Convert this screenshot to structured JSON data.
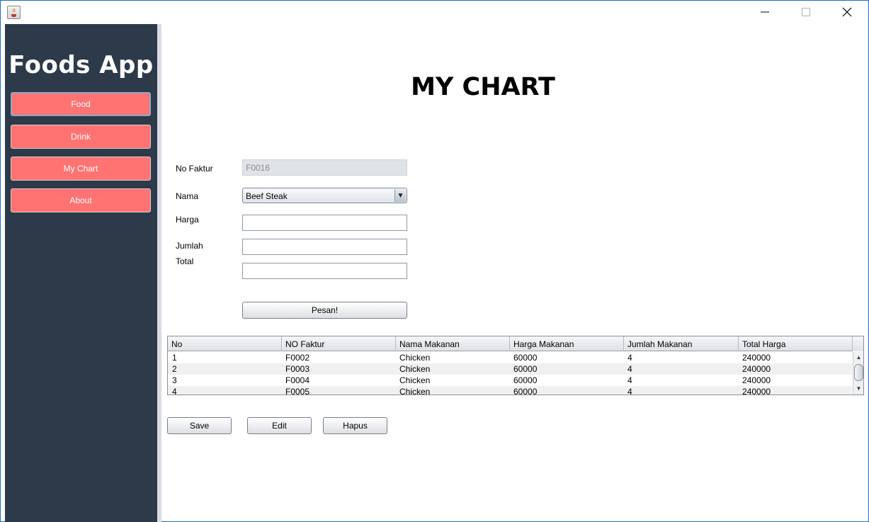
{
  "window": {
    "title": "",
    "colors": {
      "sidebar": "#2c3a4a",
      "nav_button": "#ff7373",
      "border": "#1e6ec8"
    }
  },
  "sidebar": {
    "brand": "Foods App",
    "items": [
      {
        "label": "Food"
      },
      {
        "label": "Drink"
      },
      {
        "label": "My Chart"
      },
      {
        "label": "About"
      }
    ]
  },
  "main": {
    "title": "MY CHART",
    "form": {
      "no_faktur_label": "No Faktur",
      "no_faktur_value": "F0016",
      "nama_label": "Nama",
      "nama_value": "Beef Steak",
      "harga_label": "Harga",
      "harga_value": "",
      "jumlah_label": "Jumlah",
      "jumlah_value": "",
      "total_label": "Total",
      "total_value": "",
      "submit_label": "Pesan!"
    },
    "table": {
      "columns": [
        "No",
        "NO Faktur",
        "Nama Makanan",
        "Harga Makanan",
        "Jumlah Makanan",
        "Total Harga"
      ],
      "rows": [
        [
          "1",
          "F0002",
          "Chicken",
          "60000",
          "4",
          "240000"
        ],
        [
          "2",
          "F0003",
          "Chicken",
          "60000",
          "4",
          "240000"
        ],
        [
          "3",
          "F0004",
          "Chicken",
          "60000",
          "4",
          "240000"
        ],
        [
          "4",
          "F0005",
          "Chicken",
          "60000",
          "4",
          "240000"
        ]
      ]
    },
    "actions": {
      "save_label": "Save",
      "edit_label": "Edit",
      "hapus_label": "Hapus"
    }
  }
}
